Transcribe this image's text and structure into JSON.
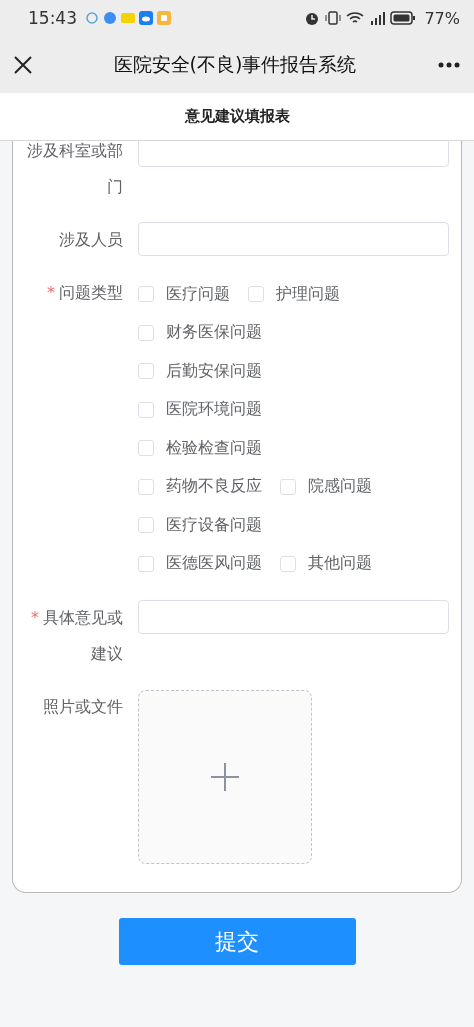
{
  "status_bar": {
    "time": "15:43",
    "battery": "77%"
  },
  "nav_bar": {
    "title": "医院安全(不良)事件报告系统"
  },
  "page_title": "意见建议填报表",
  "form": {
    "required_mark": "*",
    "fields": [
      {
        "kind": "text",
        "label": "涉及科室或部门",
        "required": false
      },
      {
        "kind": "text",
        "label": "涉及人员",
        "required": false
      },
      {
        "kind": "checkbox_group",
        "label": "问题类型",
        "required": true,
        "rows": [
          [
            {
              "label": "医疗问题",
              "checked": false
            },
            {
              "label": "护理问题",
              "checked": false
            }
          ],
          [
            {
              "label": "财务医保问题",
              "checked": false
            }
          ],
          [
            {
              "label": "后勤安保问题",
              "checked": false
            }
          ],
          [
            {
              "label": "医院环境问题",
              "checked": false
            }
          ],
          [
            {
              "label": "检验检查问题",
              "checked": false
            }
          ],
          [
            {
              "label": "药物不良反应",
              "checked": false
            },
            {
              "label": "院感问题",
              "checked": false
            }
          ],
          [
            {
              "label": "医疗设备问题",
              "checked": false
            }
          ],
          [
            {
              "label": "医德医风问题",
              "checked": false
            },
            {
              "label": "其他问题",
              "checked": false
            }
          ]
        ]
      },
      {
        "kind": "text",
        "label": "具体意见或建议",
        "required": true
      },
      {
        "kind": "upload",
        "label": "照片或文件",
        "required": false
      }
    ]
  },
  "submit_button": "提交"
}
